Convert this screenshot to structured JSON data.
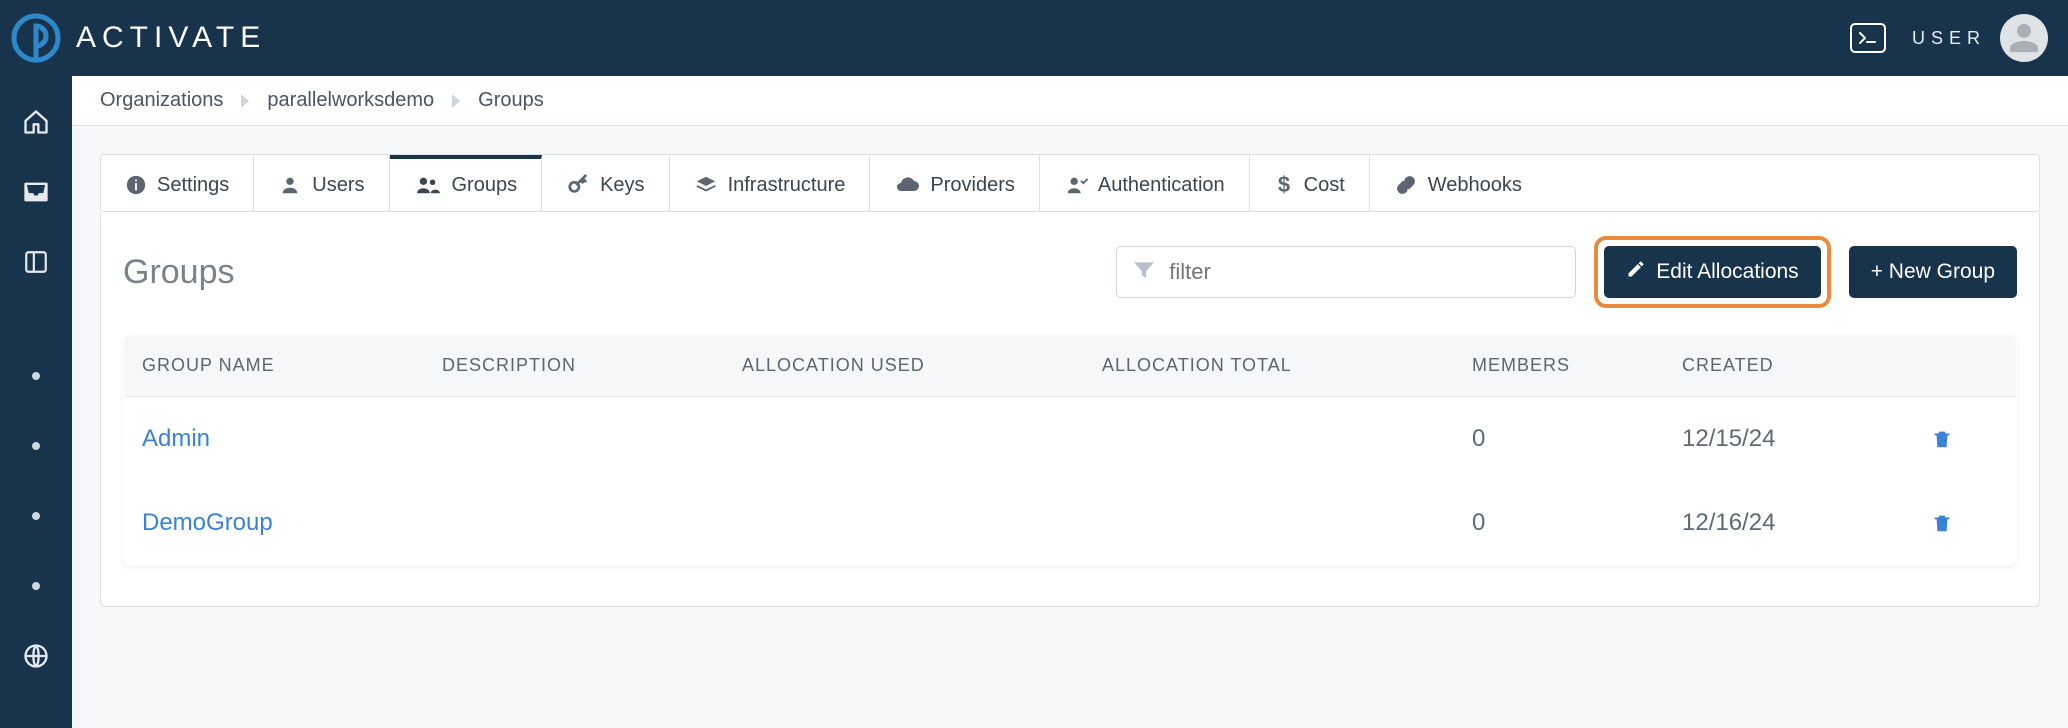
{
  "brand": {
    "name": "ACTIVATE"
  },
  "topbar": {
    "user_label": "USER"
  },
  "rail": {
    "items": [
      {
        "name": "home"
      },
      {
        "name": "inbox"
      },
      {
        "name": "panels"
      }
    ]
  },
  "breadcrumbs": [
    {
      "label": "Organizations"
    },
    {
      "label": "parallelworksdemo"
    },
    {
      "label": "Groups"
    }
  ],
  "tabs": [
    {
      "label": "Settings",
      "icon": "info"
    },
    {
      "label": "Users",
      "icon": "user"
    },
    {
      "label": "Groups",
      "icon": "group",
      "active": true
    },
    {
      "label": "Keys",
      "icon": "key"
    },
    {
      "label": "Infrastructure",
      "icon": "layers"
    },
    {
      "label": "Providers",
      "icon": "cloud"
    },
    {
      "label": "Authentication",
      "icon": "lock"
    },
    {
      "label": "Cost",
      "icon": "dollar"
    },
    {
      "label": "Webhooks",
      "icon": "link"
    }
  ],
  "panel": {
    "title": "Groups",
    "filter_placeholder": "filter",
    "edit_allocations_label": "Edit Allocations",
    "new_group_label": "+ New Group"
  },
  "table": {
    "columns": [
      "GROUP NAME",
      "DESCRIPTION",
      "ALLOCATION USED",
      "ALLOCATION TOTAL",
      "MEMBERS",
      "CREATED",
      ""
    ],
    "rows": [
      {
        "name": "Admin",
        "description": "",
        "allocation_used": "",
        "allocation_total": "",
        "members": "0",
        "created": "12/15/24"
      },
      {
        "name": "DemoGroup",
        "description": "",
        "allocation_used": "",
        "allocation_total": "",
        "members": "0",
        "created": "12/16/24"
      }
    ]
  }
}
